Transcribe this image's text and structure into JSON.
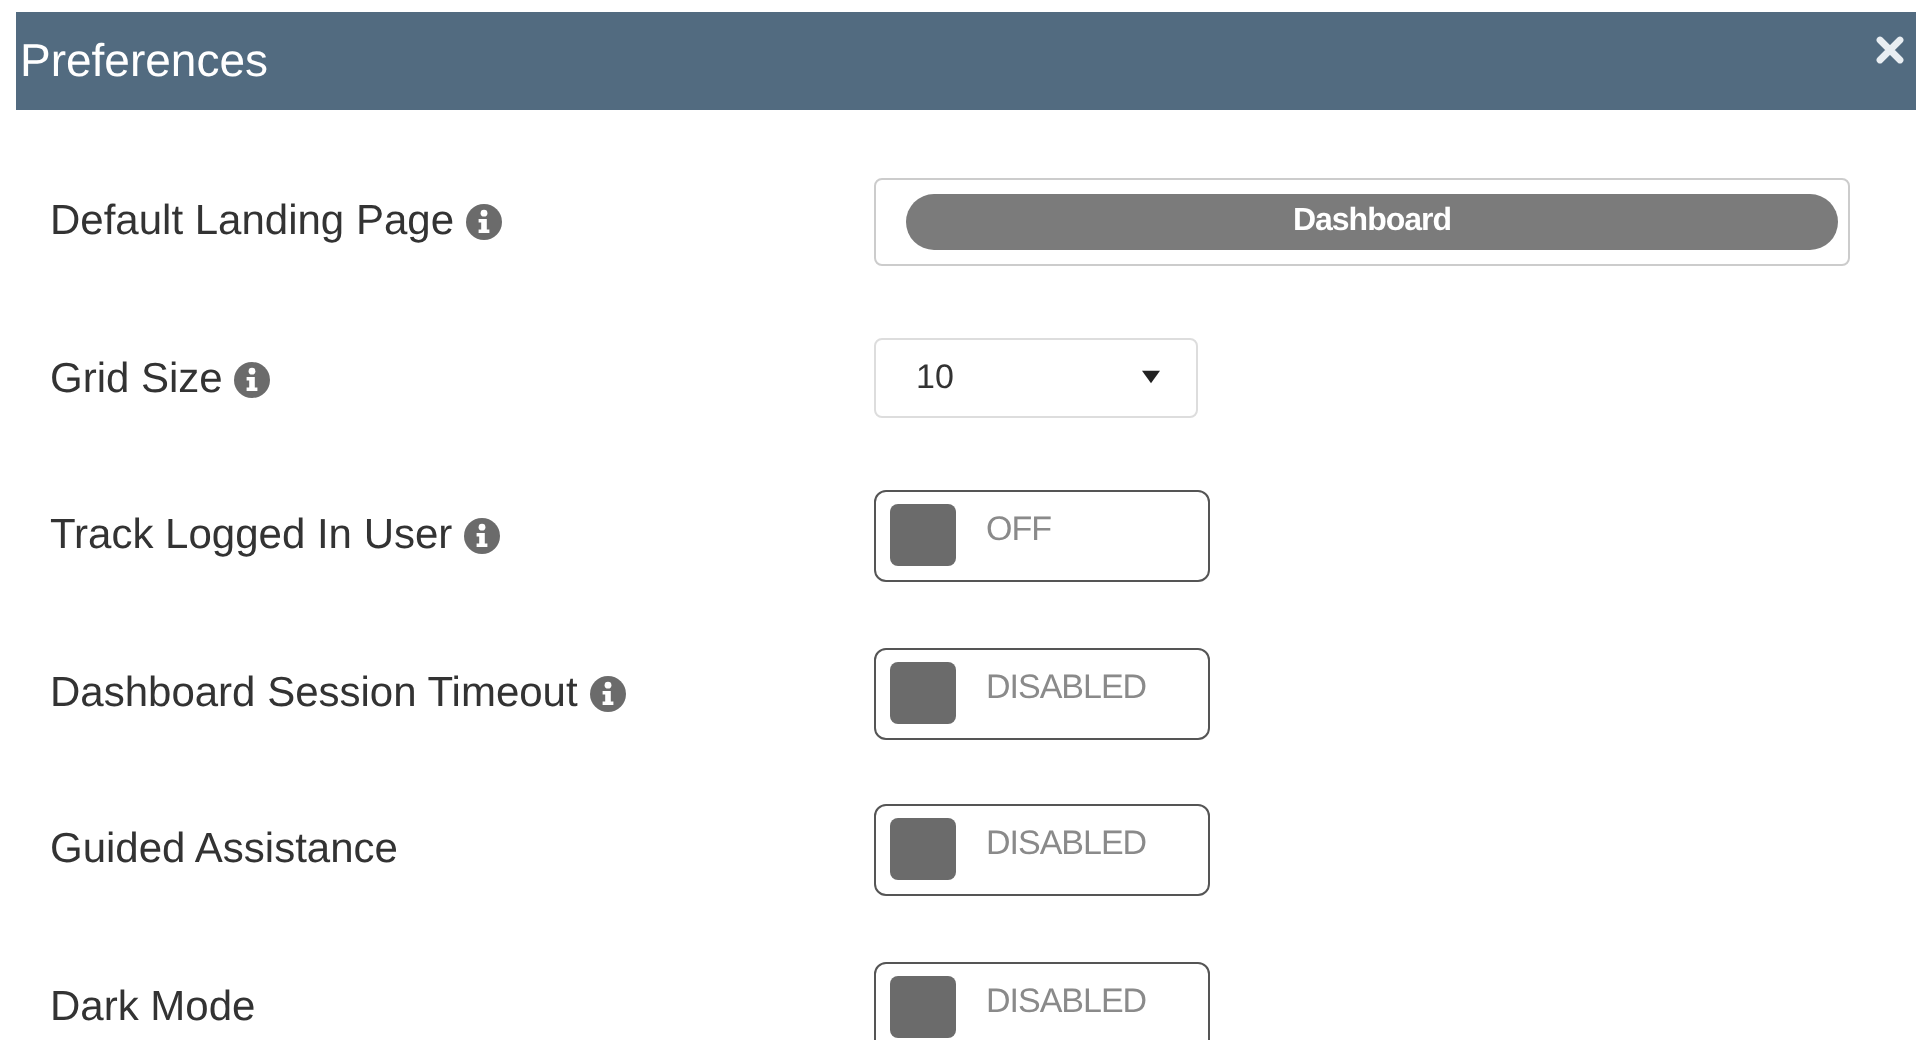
{
  "window": {
    "title": "Preferences"
  },
  "settings": [
    {
      "label": "Default Landing Page",
      "info": true,
      "kind": "pill-select",
      "value": "Dashboard"
    },
    {
      "label": "Grid Size",
      "info": true,
      "kind": "select",
      "value": "10"
    },
    {
      "label": "Track Logged In User",
      "info": true,
      "kind": "toggle",
      "on": false,
      "state_text": "OFF"
    },
    {
      "label": "Dashboard Session Timeout",
      "info": true,
      "kind": "toggle",
      "on": false,
      "state_text": "DISABLED"
    },
    {
      "label": "Guided Assistance",
      "info": false,
      "kind": "toggle",
      "on": false,
      "state_text": "DISABLED"
    },
    {
      "label": "Dark Mode",
      "info": false,
      "kind": "toggle",
      "on": false,
      "state_text": "DISABLED"
    }
  ]
}
